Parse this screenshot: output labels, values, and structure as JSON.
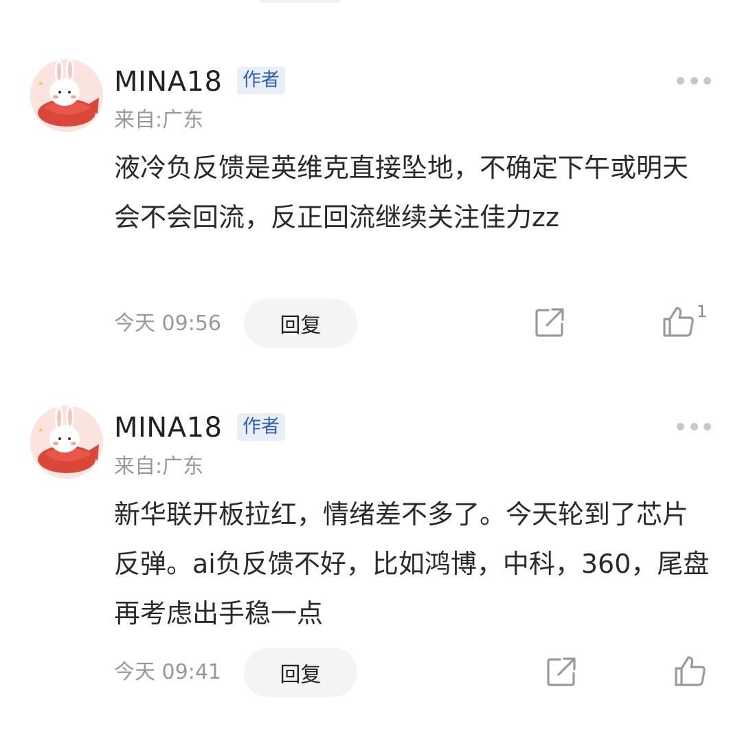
{
  "comments": [
    {
      "username": "MINA18",
      "badge": "作者",
      "location": "来自:广东",
      "text": "液冷负反馈是英维克直接坠地，不确定下午或明天会不会回流，反正回流继续关注佳力zz",
      "time": "今天 09:56",
      "reply_label": "回复",
      "like_count": "1"
    },
    {
      "username": "MINA18",
      "badge": "作者",
      "location": "来自:广东",
      "text": "新华联开板拉红，情绪差不多了。今天轮到了芯片反弹。ai负反馈不好，比如鸿博，中科，360，尾盘再考虑出手稳一点",
      "time": "今天 09:41",
      "reply_label": "回复",
      "like_count": ""
    }
  ],
  "icons": {
    "more": "more-dots-icon",
    "share": "share-icon",
    "like": "thumbs-up-icon",
    "avatar": "rabbit-with-koi-avatar"
  },
  "colors": {
    "badge_bg": "#e9eff9",
    "badge_text": "#2f5fae",
    "muted_text": "#999999",
    "reply_bg": "#f3f4f6"
  }
}
